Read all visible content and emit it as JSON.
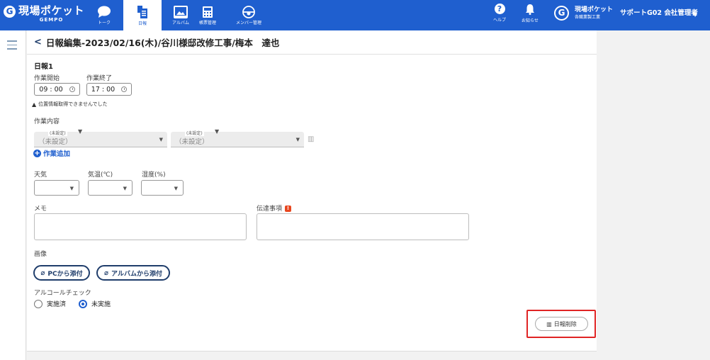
{
  "app": {
    "logo_mark": "G",
    "logo_main": "現場ポケット",
    "logo_sub": "GEMPO"
  },
  "nav": {
    "items": [
      {
        "label": "トーク",
        "icon": "chat-icon"
      },
      {
        "label": "日報",
        "icon": "report-icon",
        "active": true
      },
      {
        "label": "アルバム",
        "icon": "album-icon"
      },
      {
        "label": "帳票管理",
        "icon": "calculator-icon"
      },
      {
        "label": "メンバー管理",
        "icon": "members-icon"
      }
    ],
    "help_label": "ヘルプ",
    "notice_label": "お知らせ"
  },
  "company": {
    "mark": "G",
    "name": "現場ポケット",
    "sub": "各職業製工業"
  },
  "user": {
    "name": "サポートG02 会社管理者"
  },
  "header": {
    "back": "<",
    "title": "日報編集-2023/02/16(木)/谷川様邸改修工事/梅本　達也"
  },
  "report": {
    "section_title": "日報1",
    "start_label": "作業開始",
    "end_label": "作業終了",
    "start_value": "09 : 00",
    "end_value": "17 : 00",
    "location_warning": "位置情報取得できませんでした",
    "work_label": "作業内容",
    "select1_small": "(未設定)",
    "select1_value": "（未設定）",
    "select2_small": "(未設定)",
    "select2_value": "（未設定）",
    "add_work": "作業追加",
    "weather_label": "天気",
    "temp_label": "気温(℃)",
    "humidity_label": "湿度(%)",
    "memo_label": "メモ",
    "notice_label": "伝達事項",
    "image_label": "画像",
    "attach_pc": "PCから添付",
    "attach_album": "アルバムから添付",
    "alcohol_label": "アルコールチェック",
    "radio_done": "実施済",
    "radio_notdone": "未実施",
    "delete_button": "日報削除"
  },
  "colors": {
    "header_bg": "#1f5fcf",
    "accent": "#1f5fcf",
    "highlight": "#e02424"
  }
}
